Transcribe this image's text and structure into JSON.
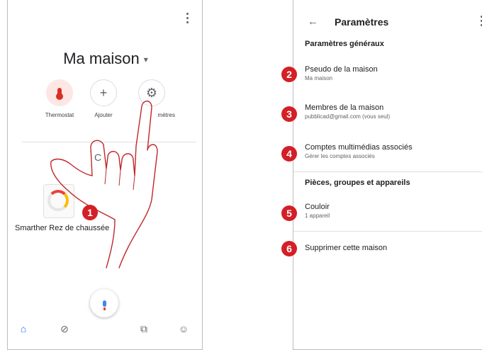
{
  "home": {
    "title": "Ma maison",
    "caret": "▾",
    "actions": [
      {
        "label": "Thermostat",
        "icon": "thermometer-icon"
      },
      {
        "label": "Ajouter",
        "icon": "plus-icon",
        "glyph": "+"
      },
      {
        "label": "mètres",
        "icon": "gear-icon",
        "glyph": "⚙"
      }
    ],
    "room_letter": "C",
    "device": {
      "name": "Smarther Rez de chaussée",
      "icon": "thermostat-dial-icon"
    },
    "nav": [
      {
        "icon": "home-icon",
        "glyph": "⌂"
      },
      {
        "icon": "compass-icon",
        "glyph": "⊘"
      },
      {
        "icon": "media-icon",
        "glyph": "⧉"
      },
      {
        "icon": "account-icon",
        "glyph": "☺"
      }
    ]
  },
  "settings": {
    "back_glyph": "←",
    "title": "Paramètres",
    "sections": [
      {
        "heading": "Paramètres généraux"
      },
      {
        "heading": "Pièces, groupes et appareils"
      }
    ],
    "items": [
      {
        "title": "Pseudo de la maison",
        "subtitle": "Ma maison"
      },
      {
        "title": "Membres de la maison",
        "subtitle": "pubblicad@gmail.com (vous seul)"
      },
      {
        "title": "Comptes multimédias associés",
        "subtitle": "Gérer les comptes associés"
      },
      {
        "title": "Couloir",
        "subtitle": "1 appareil"
      },
      {
        "title": "Supprimer cette maison",
        "subtitle": ""
      }
    ]
  },
  "badges": [
    "1",
    "2",
    "3",
    "4",
    "5",
    "6"
  ],
  "colors": {
    "badge": "#d41f26",
    "hand_outline": "#c0262b",
    "accent": "#1a73e8"
  }
}
